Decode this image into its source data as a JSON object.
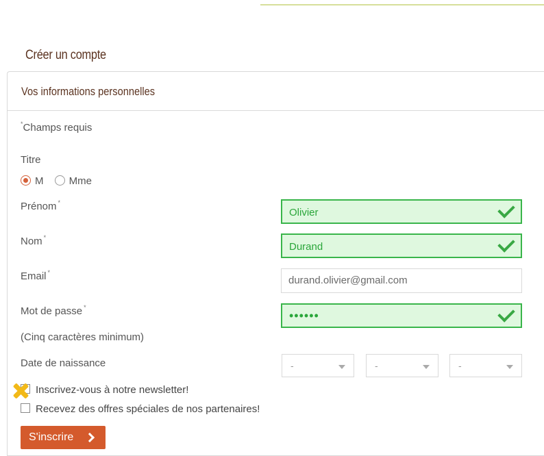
{
  "page": {
    "title": "Créer un compte"
  },
  "panel": {
    "title": "Vos informations personnelles"
  },
  "form": {
    "required_note": "Champs requis",
    "required_mark": "*",
    "titre_label": "Titre",
    "titre_options": [
      {
        "label": "M",
        "checked": true
      },
      {
        "label": "Mme",
        "checked": false
      }
    ],
    "prenom_label": "Prénom",
    "prenom_value": "Olivier",
    "nom_label": "Nom",
    "nom_value": "Durand",
    "email_label": "Email",
    "email_value": "durand.olivier@gmail.com",
    "password_label": "Mot de passe",
    "password_value": "••••••",
    "password_hint": "(Cinq caractères minimum)",
    "birthdate_label": "Date de naissance",
    "birthdate_day": "-",
    "birthdate_month": "-",
    "birthdate_year": "-",
    "newsletter_label": "Inscrivez-vous à notre newsletter!",
    "partners_label": "Recevez des offres spéciales de nos partenaires!",
    "submit_label": "S'inscrire"
  },
  "colors": {
    "accent": "#d45a2c",
    "valid_border": "#39b54a",
    "valid_bg": "#dff8df",
    "title_brown": "#5b3320",
    "marker_yellow": "#f2b918"
  },
  "icons": {
    "valid": "checkmark-icon",
    "dropdown": "chevron-down-icon",
    "submit": "chevron-right-icon",
    "marker": "x-marker-icon"
  }
}
